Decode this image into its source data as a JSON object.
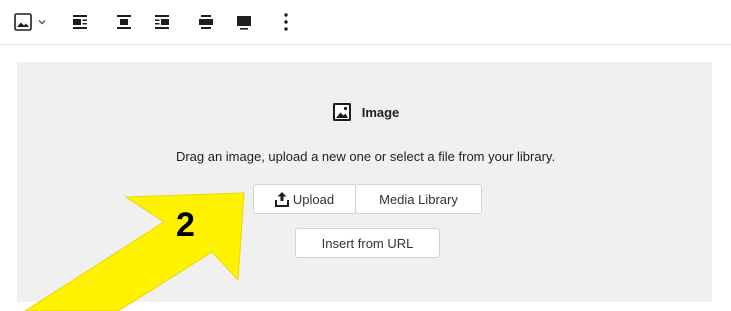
{
  "toolbar": {
    "icons": [
      "image-icon",
      "chevron-down-icon",
      "align-left-icon",
      "align-center-icon",
      "align-right-icon",
      "align-wide-icon",
      "align-full-icon",
      "more-options-icon"
    ]
  },
  "placeholder": {
    "title": "Image",
    "instructions": "Drag an image, upload a new one or select a file from your library.",
    "upload_label": "Upload",
    "media_library_label": "Media Library",
    "insert_url_label": "Insert from URL"
  },
  "annotation": {
    "step": "2",
    "arrow_color": "#fff200"
  }
}
